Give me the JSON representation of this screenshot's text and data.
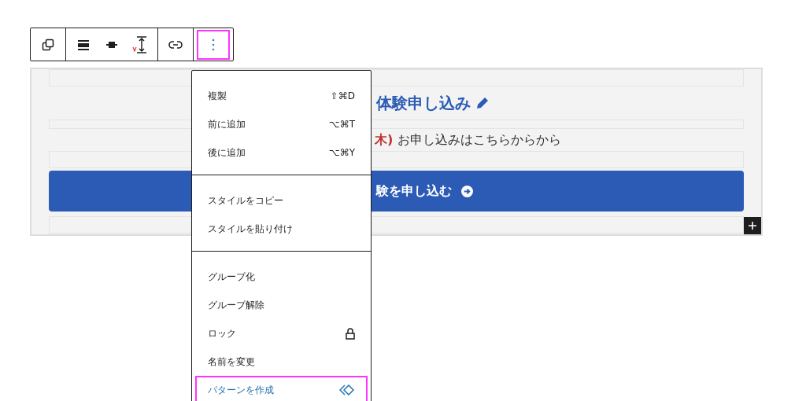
{
  "toolbar": {
    "groups": [
      [
        {
          "kind": "duplicate",
          "highlighted": false
        }
      ],
      [
        {
          "kind": "wide",
          "highlighted": false
        },
        {
          "kind": "center",
          "highlighted": false
        },
        {
          "kind": "height",
          "highlighted": false
        }
      ],
      [
        {
          "kind": "link",
          "highlighted": false
        }
      ],
      [
        {
          "kind": "more",
          "highlighted": true
        }
      ]
    ]
  },
  "block": {
    "heading": "体験申し込み",
    "note_date": "木)",
    "note": "お申し込みはこちらからから",
    "button": "験を申し込む"
  },
  "menu": {
    "sections": [
      [
        {
          "label": "複製",
          "shortcut": "⇧⌘D",
          "highlighted": false
        },
        {
          "label": "前に追加",
          "shortcut": "⌥⌘T",
          "highlighted": false
        },
        {
          "label": "後に追加",
          "shortcut": "⌥⌘Y",
          "highlighted": false
        }
      ],
      [
        {
          "label": "スタイルをコピー",
          "highlighted": false
        },
        {
          "label": "スタイルを貼り付け",
          "highlighted": false
        }
      ],
      [
        {
          "label": "グループ化",
          "highlighted": false
        },
        {
          "label": "グループ解除",
          "highlighted": false
        },
        {
          "label": "ロック",
          "kind": "lock",
          "highlighted": false
        },
        {
          "label": "名前を変更",
          "highlighted": false
        },
        {
          "label": "パターンを作成",
          "kind": "pattern",
          "highlighted": true
        }
      ]
    ]
  }
}
